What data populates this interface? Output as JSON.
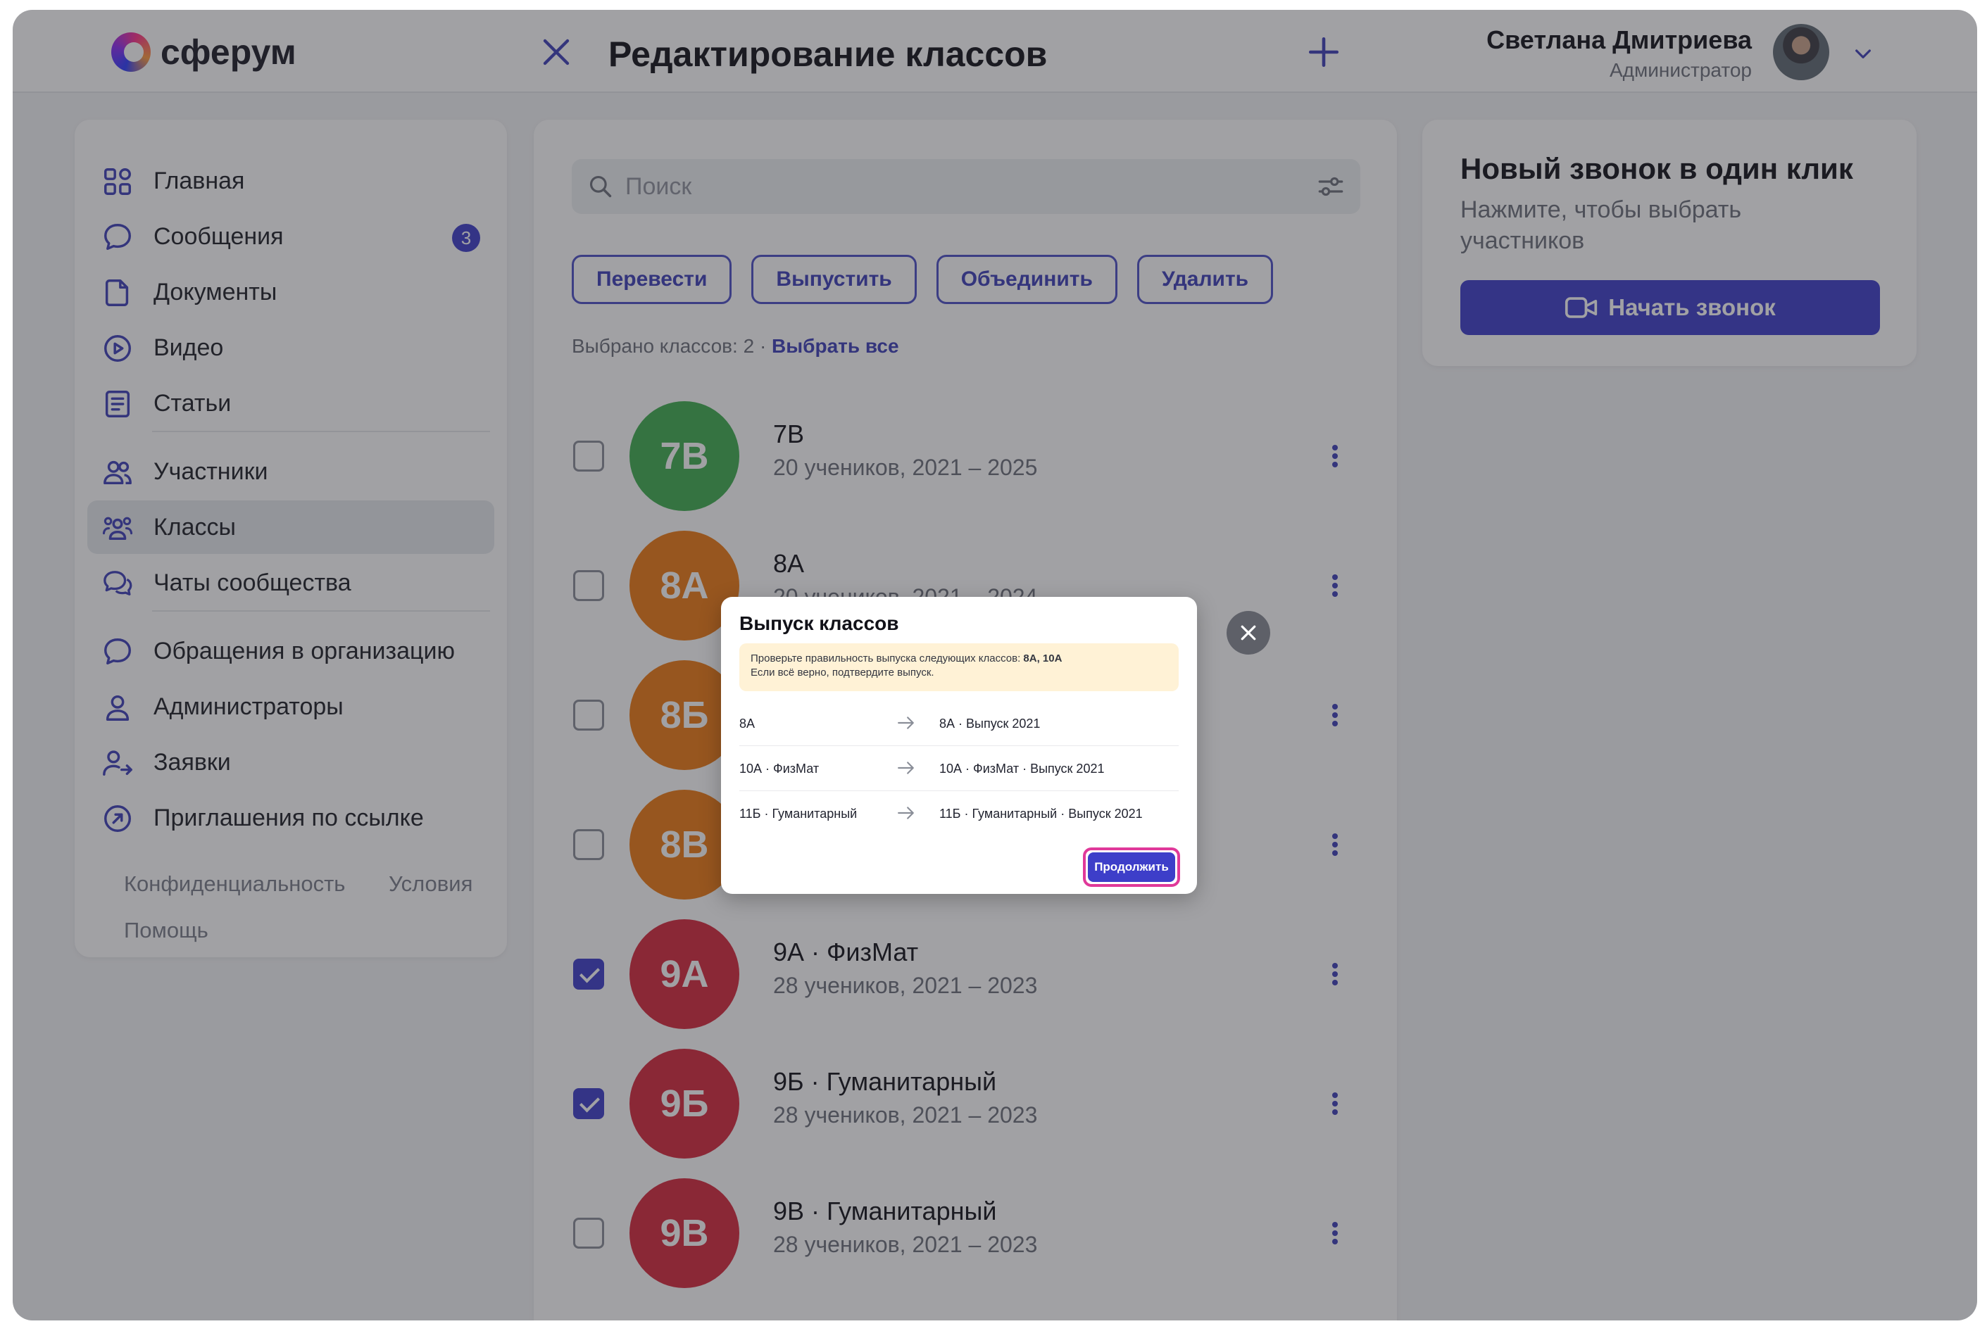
{
  "header": {
    "logo_text": "сферум",
    "title": "Редактирование классов",
    "user_name": "Светлана Дмитриева",
    "user_role": "Администратор"
  },
  "sidebar": {
    "items": [
      {
        "label": "Главная"
      },
      {
        "label": "Сообщения",
        "badge": "3"
      },
      {
        "label": "Документы"
      },
      {
        "label": "Видео"
      },
      {
        "label": "Статьи"
      },
      {
        "label": "Участники"
      },
      {
        "label": "Классы"
      },
      {
        "label": "Чаты сообщества"
      },
      {
        "label": "Обращения в организацию"
      },
      {
        "label": "Администраторы"
      },
      {
        "label": "Заявки"
      },
      {
        "label": "Приглашения по ссылке"
      }
    ],
    "footer": {
      "privacy": "Конфиденциальность",
      "terms": "Условия",
      "help": "Помощь"
    }
  },
  "main": {
    "search_placeholder": "Поиск",
    "buttons": {
      "transfer": "Перевести",
      "graduate": "Выпустить",
      "merge": "Объединить",
      "delete": "Удалить"
    },
    "selected_text": "Выбрано классов: 2 · ",
    "select_all": "Выбрать все",
    "classes": [
      {
        "abbr": "7В",
        "title": "7В",
        "subtitle": "20 учеников, 2021 – 2025",
        "color": "#3fae4f",
        "checked": false
      },
      {
        "abbr": "8А",
        "title": "8А",
        "subtitle": "20 учеников, 2021 – 2024",
        "color": "#ee7a12",
        "checked": false
      },
      {
        "abbr": "8Б",
        "title": "",
        "subtitle": "",
        "color": "#ee7a12",
        "checked": false
      },
      {
        "abbr": "8В",
        "title": "",
        "subtitle": "",
        "color": "#ee7a12",
        "checked": false
      },
      {
        "abbr": "9А",
        "title": "9А · ФизМат",
        "subtitle": "28 учеников, 2021 – 2023",
        "color": "#d6283b",
        "checked": true
      },
      {
        "abbr": "9Б",
        "title": "9Б · Гуманитарный",
        "subtitle": "28 учеников, 2021 – 2023",
        "color": "#d6283b",
        "checked": true
      },
      {
        "abbr": "9В",
        "title": "9В · Гуманитарный",
        "subtitle": "28 учеников, 2021 – 2023",
        "color": "#d6283b",
        "checked": false
      }
    ]
  },
  "call_card": {
    "title": "Новый звонок в один клик",
    "description": "Нажмите, чтобы выбрать участников",
    "button": "Начать звонок"
  },
  "dialog": {
    "title": "Выпуск классов",
    "note_line1": "Проверьте правильность выпуска следующих классов: ",
    "note_classes": "8А, 10А",
    "note_line2": "Если всё верно, подтвердите выпуск.",
    "rows": [
      {
        "from": "8А",
        "to": "8А · Выпуск 2021"
      },
      {
        "from": "10А · ФизМат",
        "to": "10А · ФизМат · Выпуск 2021"
      },
      {
        "from": "11Б · Гуманитарный",
        "to": "11Б · Гуманитарный · Выпуск 2021"
      }
    ],
    "continue": "Продолжить"
  },
  "colors": {
    "accent": "#3d3ec9",
    "highlight_ring": "#e0399a",
    "note_bg": "#fff2d6"
  }
}
